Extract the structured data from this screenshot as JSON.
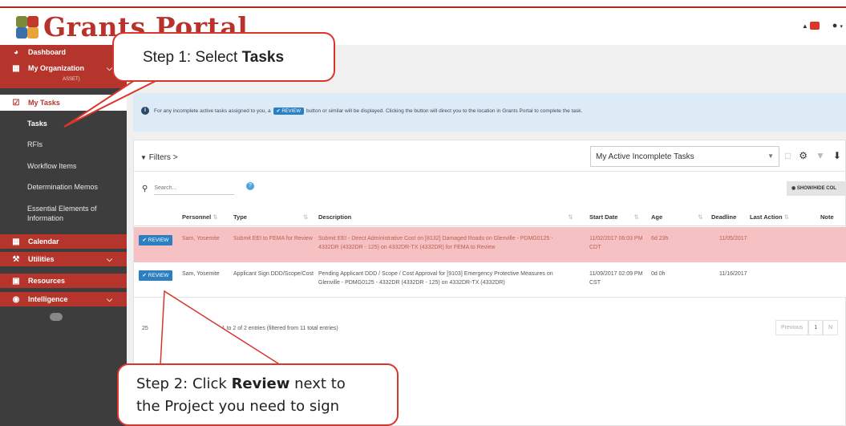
{
  "app": {
    "title": "Grants Portal"
  },
  "sidebar": {
    "items": [
      {
        "label": "Dashboard",
        "icon": "dashboard-icon"
      },
      {
        "label": "My Organization",
        "icon": "building-icon",
        "sub": "ASSET)"
      },
      {
        "label": "My Tasks",
        "icon": "checkbox-icon"
      },
      {
        "label": "Calendar",
        "icon": "calendar-icon"
      },
      {
        "label": "Utilities",
        "icon": "wrench-icon"
      },
      {
        "label": "Resources",
        "icon": "book-icon"
      },
      {
        "label": "Intelligence",
        "icon": "eye-icon"
      }
    ],
    "subitems": [
      "Tasks",
      "RFIs",
      "Workflow Items",
      "Determination Memos",
      "Essential Elements of Information"
    ]
  },
  "banner": {
    "text_before": "For any incomplete active tasks assigned to you, a",
    "button_label": "REVIEW",
    "text_after": "button or similar will be displayed. Clicking the button will direct you to the location in Grants Portal to complete the task."
  },
  "toolbar": {
    "filters_label": "Filters >",
    "view_select": "My Active Incomplete Tasks",
    "search_placeholder": "Search...",
    "show_hide_label": "SHOW/HIDE COL"
  },
  "table": {
    "columns": [
      "Personnel",
      "Type",
      "Description",
      "Start Date",
      "Age",
      "Deadline",
      "Last Action",
      "Note"
    ],
    "rows": [
      {
        "action": "REVIEW",
        "personnel": "Sam, Yosemite",
        "type": "Submit EEI to FEMA for Review",
        "description": "Submit EEI - Direct Administrative Cost on [8132] Damaged Roads on Glenville - PDMG0125 - 4332DR (4332DR - 125) on 4332DR-TX (4332DR) for FEMA to Review",
        "start_date": "11/02/2017 06:03 PM CDT",
        "age": "6d 23h",
        "deadline": "11/05/2017"
      },
      {
        "action": "REVIEW",
        "personnel": "Sam, Yosemite",
        "type": "Applicant Sign DDD/Scope/Cost",
        "description": "Pending Applicant DDD / Scope / Cost Approval for [9103] Emergency Protective Measures on Glenville - PDMG0125 - 4332DR (4332DR - 125) on 4332DR-TX (4332DR)",
        "start_date": "11/09/2017 02:09 PM CST",
        "age": "0d 0h",
        "deadline": "11/16/2017"
      }
    ]
  },
  "footer": {
    "page_size": "25",
    "info": "ng 1 to 2 of 2 entries (filtered from 11 total entries)",
    "previous": "Previous",
    "page": "1",
    "next": "N"
  },
  "callouts": {
    "step1_prefix": "Step 1: Select ",
    "step1_bold": "Tasks",
    "step2_line1_prefix": "Step 2: Click ",
    "step2_bold": "Review",
    "step2_line1_suffix": " next to",
    "step2_line2": "the Project you need to sign"
  },
  "colors": {
    "brand_red": "#b5352c",
    "review_blue": "#2c7fc1",
    "highlight_row": "#f5c1c3",
    "banner": "#dcebf6"
  }
}
